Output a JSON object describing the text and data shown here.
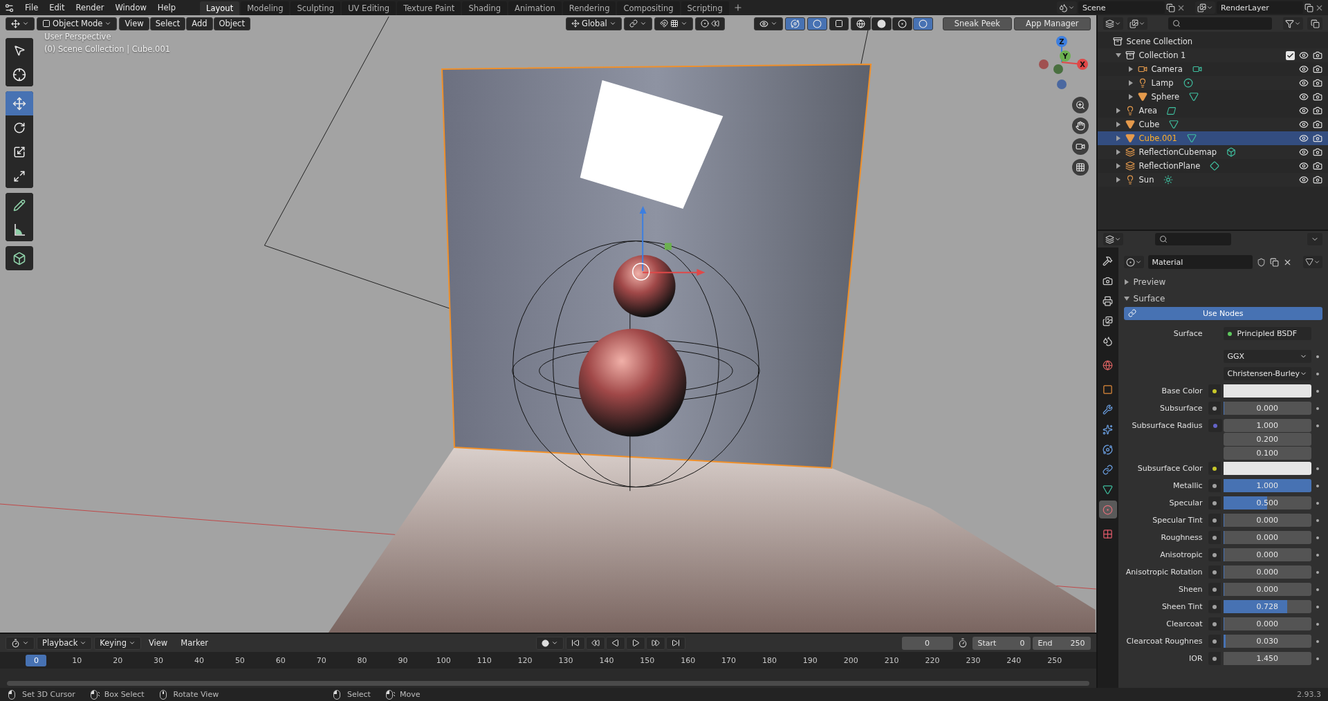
{
  "topbar": {
    "menus": [
      "File",
      "Edit",
      "Render",
      "Window",
      "Help"
    ],
    "workspaces": [
      {
        "label": "Layout",
        "selected": true
      },
      {
        "label": "Modeling",
        "selected": false
      },
      {
        "label": "Sculpting",
        "selected": false
      },
      {
        "label": "UV Editing",
        "selected": false
      },
      {
        "label": "Texture Paint",
        "selected": false
      },
      {
        "label": "Shading",
        "selected": false
      },
      {
        "label": "Animation",
        "selected": false
      },
      {
        "label": "Rendering",
        "selected": false
      },
      {
        "label": "Compositing",
        "selected": false
      },
      {
        "label": "Scripting",
        "selected": false
      }
    ],
    "scene": "Scene",
    "view_layer": "RenderLayer"
  },
  "viewport": {
    "mode": "Object Mode",
    "menus": [
      "View",
      "Select",
      "Add",
      "Object"
    ],
    "orientation": "Global",
    "shading_modes": [
      {
        "kind": "wire",
        "selected": false
      },
      {
        "kind": "solid",
        "selected": false
      },
      {
        "kind": "material",
        "selected": false
      },
      {
        "kind": "rendered",
        "selected": true
      }
    ],
    "buttons": [
      "Sneak Peek",
      "App Manager"
    ],
    "overlay_text": [
      "User Perspective",
      "(0) Scene Collection | Cube.001"
    ],
    "tool_groups": [
      [
        {
          "kind": "select",
          "selected": false
        },
        {
          "kind": "cursor",
          "selected": false
        }
      ],
      [
        {
          "kind": "move",
          "selected": true
        },
        {
          "kind": "rotate",
          "selected": false
        },
        {
          "kind": "scale",
          "selected": false
        },
        {
          "kind": "transform",
          "selected": false
        }
      ],
      [
        {
          "kind": "annotate",
          "selected": false
        },
        {
          "kind": "measure",
          "selected": false
        }
      ],
      [
        {
          "kind": "add-cube",
          "selected": false
        }
      ]
    ],
    "gizmo_axes": [
      "Z",
      "Y",
      "X"
    ]
  },
  "outliner": {
    "items": [
      {
        "name": "Scene Collection",
        "kind": "collection",
        "selected": false,
        "children": [
          {
            "name": "Collection 1",
            "kind": "collection",
            "expanded": true,
            "checked": true,
            "selected": false,
            "children": [
              {
                "name": "Camera",
                "kind": "camera",
                "expanded": false,
                "selected": false
              },
              {
                "name": "Lamp",
                "kind": "point",
                "expanded": false,
                "selected": false
              },
              {
                "name": "Sphere",
                "kind": "mesh",
                "expanded": false,
                "selected": false
              }
            ]
          },
          {
            "name": "Area",
            "kind": "area",
            "expanded": false,
            "selected": false
          },
          {
            "name": "Cube",
            "kind": "mesh",
            "expanded": false,
            "selected": false
          },
          {
            "name": "Cube.001",
            "kind": "mesh",
            "expanded": false,
            "selected": true
          },
          {
            "name": "ReflectionCubemap",
            "kind": "cubemap",
            "expanded": false,
            "selected": false
          },
          {
            "name": "ReflectionPlane",
            "kind": "plane",
            "expanded": false,
            "selected": false
          },
          {
            "name": "Sun",
            "kind": "sun",
            "expanded": false,
            "selected": false
          }
        ]
      }
    ]
  },
  "properties": {
    "tabs": [
      {
        "kind": "tool",
        "selected": false
      },
      {
        "kind": "render",
        "selected": false
      },
      {
        "kind": "output",
        "selected": false
      },
      {
        "kind": "view-layer",
        "selected": false
      },
      {
        "kind": "scene",
        "selected": false
      },
      {
        "kind": "world",
        "selected": false
      },
      {
        "kind": "object",
        "selected": false
      },
      {
        "kind": "modifier",
        "selected": false
      },
      {
        "kind": "particles",
        "selected": false
      },
      {
        "kind": "physics",
        "selected": false
      },
      {
        "kind": "constraints",
        "selected": false
      },
      {
        "kind": "data",
        "selected": false
      },
      {
        "kind": "material",
        "selected": true
      },
      {
        "kind": "texture",
        "selected": false
      }
    ],
    "material": "Material",
    "panels": [
      {
        "title": "Preview",
        "expanded": false
      },
      {
        "title": "Surface",
        "expanded": true
      }
    ],
    "use_nodes": "Use Nodes",
    "surface_label": "Surface",
    "surface_shader": "Principled BSDF",
    "dropdowns": [
      "GGX",
      "Christensen-Burley"
    ],
    "fields": [
      {
        "label": "Base Color",
        "kind": "color"
      },
      {
        "label": "Subsurface",
        "kind": "slider",
        "value": "0.000",
        "level": 0
      },
      {
        "label": "Subsurface Radius",
        "kind": "vector",
        "values": [
          "1.000",
          "0.200",
          "0.100"
        ]
      },
      {
        "label": "Subsurface Color",
        "kind": "color"
      },
      {
        "label": "Metallic",
        "kind": "slider",
        "value": "1.000",
        "level": 1
      },
      {
        "label": "Specular",
        "kind": "slider",
        "value": "0.500",
        "level": 0.5
      },
      {
        "label": "Specular Tint",
        "kind": "slider",
        "value": "0.000",
        "level": 0
      },
      {
        "label": "Roughness",
        "kind": "slider",
        "value": "0.000",
        "level": 0
      },
      {
        "label": "Anisotropic",
        "kind": "slider",
        "value": "0.000",
        "level": 0
      },
      {
        "label": "Anisotropic Rotation",
        "kind": "slider",
        "value": "0.000",
        "level": 0
      },
      {
        "label": "Sheen",
        "kind": "slider",
        "value": "0.000",
        "level": 0
      },
      {
        "label": "Sheen Tint",
        "kind": "slider",
        "value": "0.728",
        "level": 0.728
      },
      {
        "label": "Clearcoat",
        "kind": "slider",
        "value": "0.000",
        "level": 0
      },
      {
        "label": "Clearcoat Roughnes",
        "kind": "slider",
        "value": "0.030",
        "level": 0.03
      },
      {
        "label": "IOR",
        "kind": "number",
        "value": "1.450"
      }
    ]
  },
  "timeline": {
    "menus": [
      {
        "label": "Playback",
        "dropdown": true
      },
      {
        "label": "Keying",
        "dropdown": true
      },
      {
        "label": "View",
        "dropdown": false
      },
      {
        "label": "Marker",
        "dropdown": false
      }
    ],
    "current_frame": "0",
    "range": [
      {
        "label": "Start",
        "value": "0"
      },
      {
        "label": "End",
        "value": "250"
      }
    ],
    "playhead": "0",
    "ticks": [
      "10",
      "20",
      "30",
      "40",
      "50",
      "60",
      "70",
      "80",
      "90",
      "100",
      "110",
      "120",
      "130",
      "140",
      "150",
      "160",
      "170",
      "180",
      "190",
      "200",
      "210",
      "220",
      "230",
      "240",
      "250"
    ]
  },
  "status_bar": {
    "groups": [
      [
        {
          "label": "Set 3D Cursor",
          "kind": "click"
        },
        {
          "label": "Box Select",
          "kind": "drag"
        },
        {
          "label": "Rotate View",
          "kind": "middle"
        }
      ],
      [
        {
          "label": "Select",
          "kind": "click"
        },
        {
          "label": "Move",
          "kind": "drag"
        }
      ]
    ],
    "version": "2.93.3"
  }
}
